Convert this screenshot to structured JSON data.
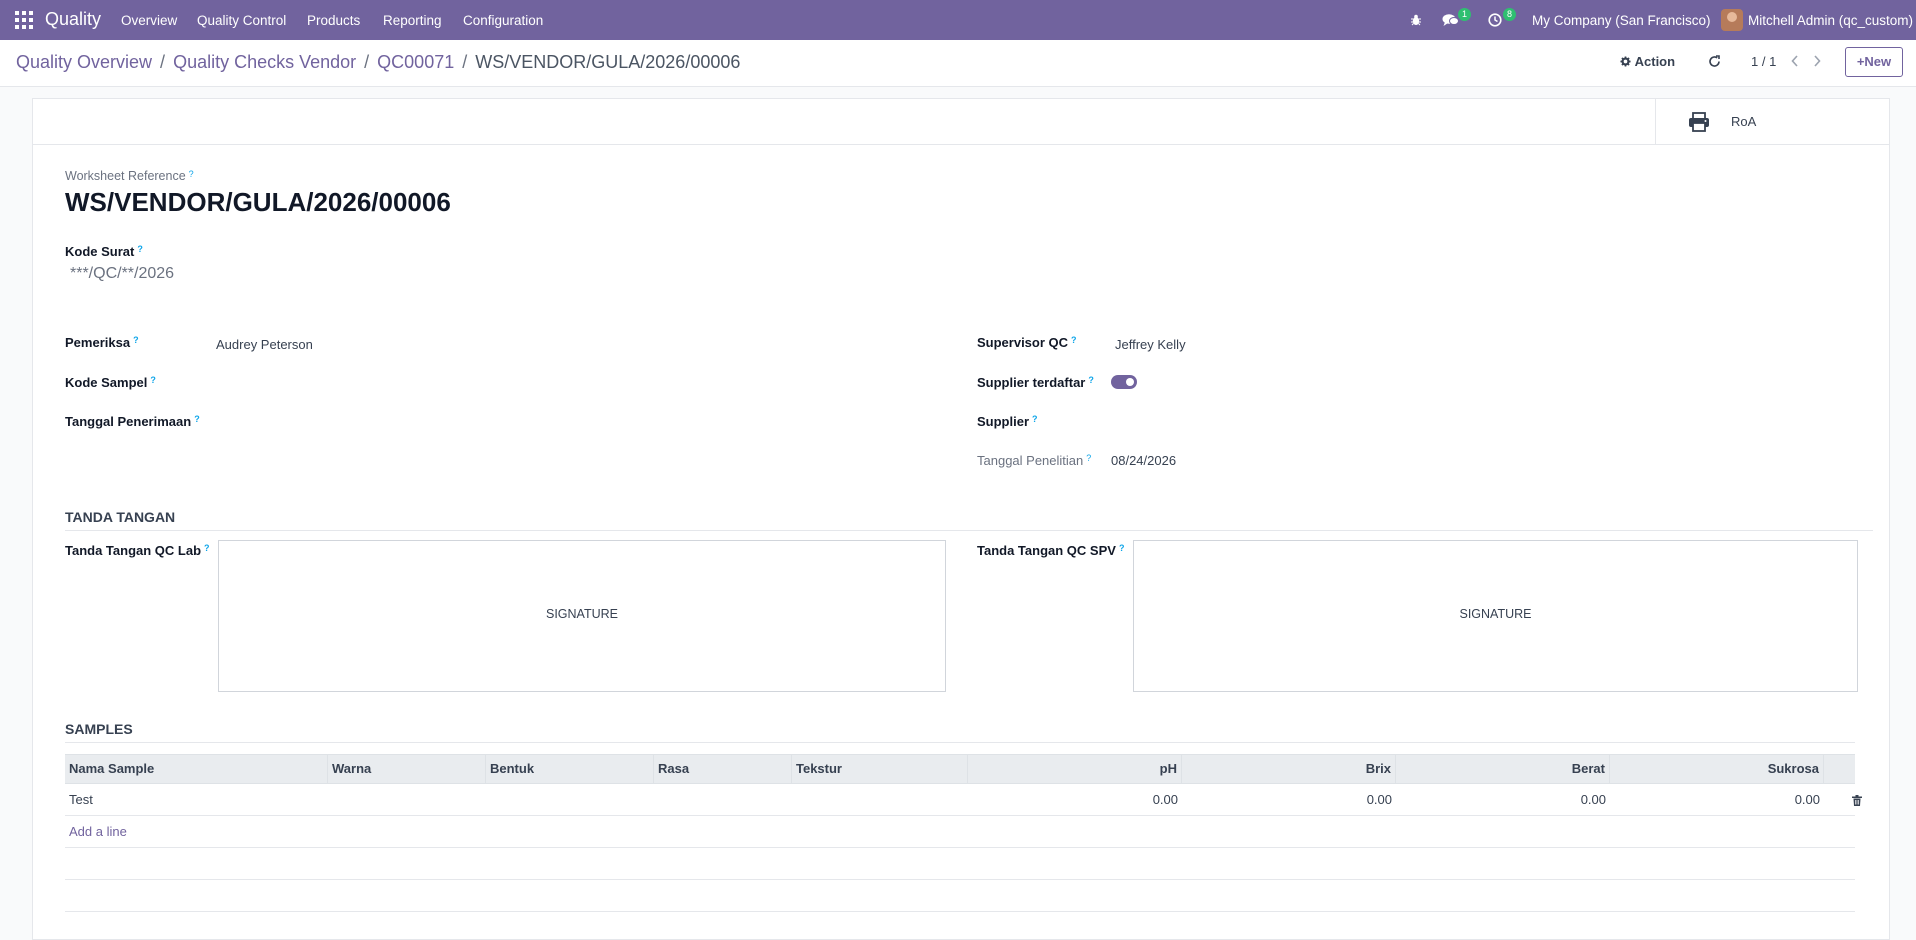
{
  "navbar": {
    "app_name": "Quality",
    "menu": [
      "Overview",
      "Quality Control",
      "Products",
      "Reporting",
      "Configuration"
    ],
    "messages_badge": "1",
    "activities_badge": "8",
    "company": "My Company (San Francisco)",
    "user": "Mitchell Admin (qc_custom)"
  },
  "breadcrumb": {
    "items": [
      "Quality Overview",
      "Quality Checks Vendor",
      "QC00071"
    ],
    "current": "WS/VENDOR/GULA/2026/00006"
  },
  "control": {
    "action_label": "Action",
    "pager": "1 / 1",
    "new_label": "New"
  },
  "smart_button": {
    "label": "RoA"
  },
  "form": {
    "ref_label": "Worksheet Reference",
    "ref_value": "WS/VENDOR/GULA/2026/00006",
    "kode_surat_label": "Kode Surat",
    "kode_surat_value": "***/QC/**/2026",
    "pemeriksa_label": "Pemeriksa",
    "pemeriksa_value": "Audrey Peterson",
    "kode_sampel_label": "Kode Sampel",
    "tanggal_penerimaan_label": "Tanggal Penerimaan",
    "supervisor_label": "Supervisor QC",
    "supervisor_value": "Jeffrey Kelly",
    "supplier_terdaftar_label": "Supplier terdaftar",
    "supplier_terdaftar_value": true,
    "supplier_label": "Supplier",
    "tanggal_penelitian_label": "Tanggal Penelitian",
    "tanggal_penelitian_value": "08/24/2026",
    "tanda_tangan_title": "TANDA TANGAN",
    "ttd_lab_label": "Tanda Tangan QC Lab",
    "ttd_spv_label": "Tanda Tangan QC SPV",
    "signature_label": "SIGNATURE",
    "samples_title": "SAMPLES"
  },
  "samples_table": {
    "columns": [
      "Nama Sample",
      "Warna",
      "Bentuk",
      "Rasa",
      "Tekstur",
      "pH",
      "Brix",
      "Berat",
      "Sukrosa"
    ],
    "rows": [
      {
        "nama": "Test",
        "warna": "",
        "bentuk": "",
        "rasa": "",
        "tekstur": "",
        "ph": "0.00",
        "brix": "0.00",
        "berat": "0.00",
        "sukrosa": "0.00"
      }
    ],
    "add_line": "Add a line"
  },
  "colors": {
    "brand": "#71639e",
    "badge": "#2fbf71",
    "help": "#0ea5e9"
  },
  "icons": [
    "apps-grid-icon",
    "bug-icon",
    "chat-icon",
    "clock-icon",
    "gear-icon",
    "refresh-icon",
    "chevron-left-icon",
    "chevron-right-icon",
    "plus-icon",
    "printer-icon",
    "trash-icon"
  ]
}
